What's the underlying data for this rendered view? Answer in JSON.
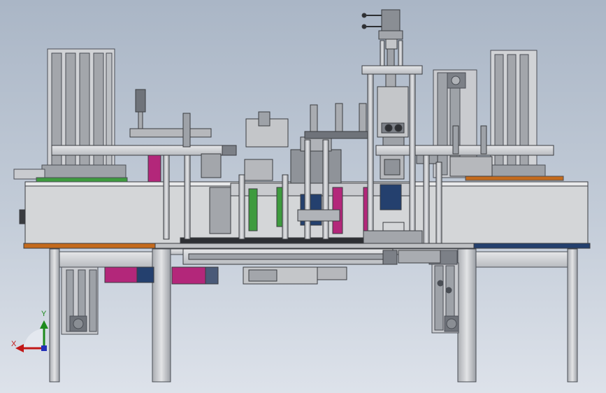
{
  "diagram": {
    "kind": "cad-machine-front-view",
    "colors": {
      "background_top": "#aab6c6",
      "background_bottom": "#dde2ea",
      "frame": "#c8c9cc",
      "frame_dark": "#6f737a",
      "plate": "#d4d6d8",
      "orange_trim": "#c46a1c",
      "blue_trim": "#24406e",
      "magenta": "#b3277a",
      "green_part": "#3e9b3e",
      "axis_x": "#c21818",
      "axis_y": "#1d8a1d",
      "axis_z": "#2330b8"
    }
  },
  "axis_triad": {
    "y_label": "Y",
    "x_label": "X"
  }
}
